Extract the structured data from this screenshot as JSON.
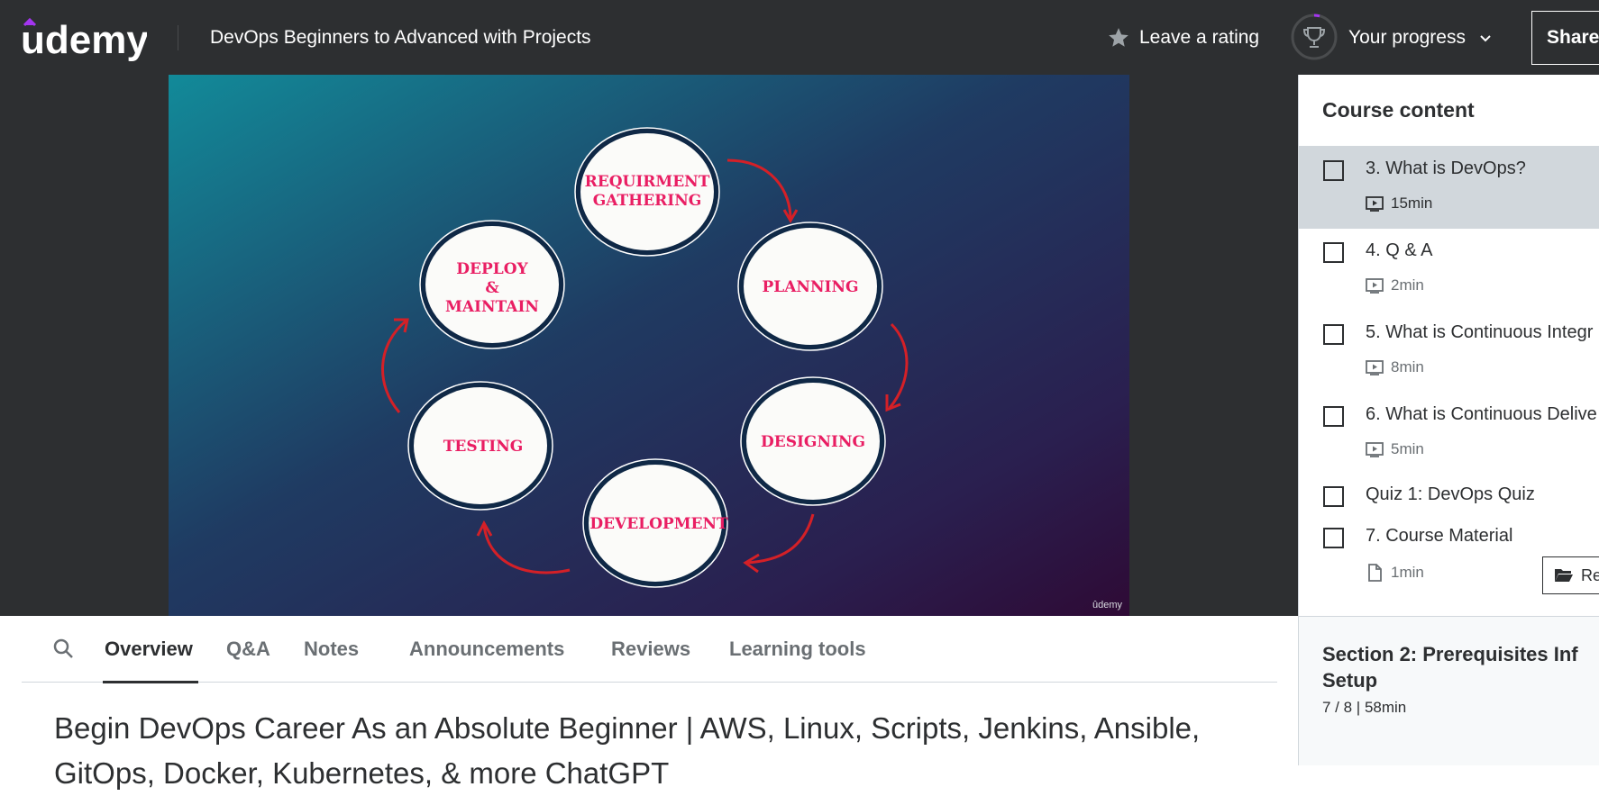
{
  "header": {
    "logo_text": "udemy",
    "course_title": "DevOps Beginners to Advanced with Projects",
    "leave_rating": "Leave a rating",
    "your_progress": "Your progress",
    "share": "Share"
  },
  "slide": {
    "stages": [
      "REQUIRMENT GATHERING",
      "PLANNING",
      "DESIGNING",
      "DEVELOPMENT",
      "TESTING",
      "DEPLOY & MAINTAIN"
    ],
    "watermark": "ûdemy"
  },
  "sidebar": {
    "heading": "Course content",
    "lectures": [
      {
        "title": "3. What is DevOps?",
        "duration": "15min"
      },
      {
        "title": "4. Q & A",
        "duration": "2min"
      },
      {
        "title": "5. What is Continuous Integr",
        "duration": "8min"
      },
      {
        "title": "6. What is Continuous Delive",
        "duration": "5min"
      },
      {
        "title": "Quiz 1: DevOps Quiz"
      },
      {
        "title": "7. Course Material",
        "duration": "1min",
        "resources": "Re"
      }
    ],
    "section": {
      "title": "Section 2: Prerequisites Inf Setup",
      "meta": "7 / 8 | 58min"
    }
  },
  "tabs": [
    "Overview",
    "Q&A",
    "Notes",
    "Announcements",
    "Reviews",
    "Learning tools"
  ],
  "overview": {
    "title": "Begin DevOps Career As an Absolute Beginner | AWS, Linux, Scripts, Jenkins, Ansible, GitOps, Docker, Kubernetes, & more ChatGPT"
  },
  "colors": {
    "header_bg": "#2d2f31",
    "brand_purple": "#a435f0",
    "slide_label": "#e91e63",
    "arrow": "#d42027"
  }
}
